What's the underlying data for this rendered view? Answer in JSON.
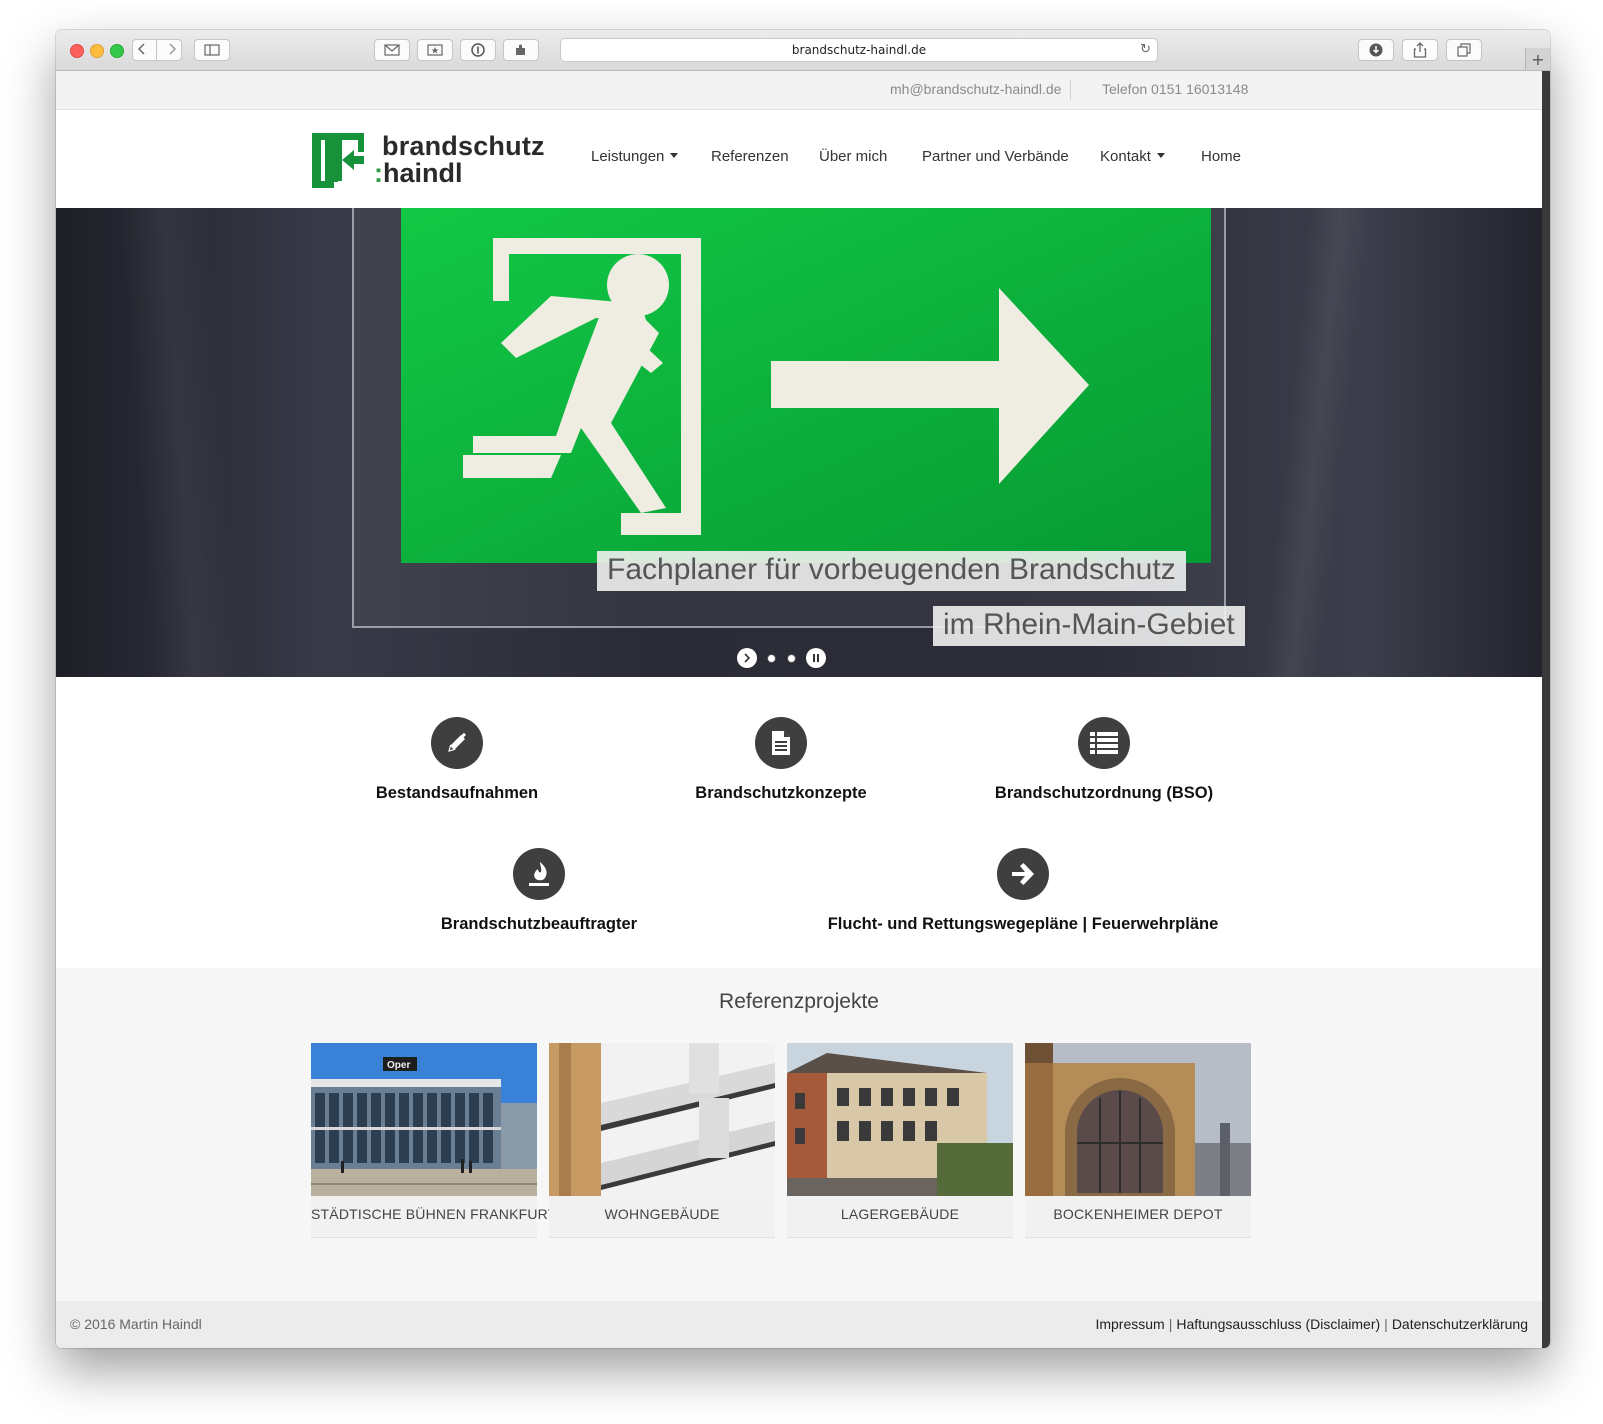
{
  "browser": {
    "url": "brandschutz-haindl.de"
  },
  "topbar": {
    "email": "mh@brandschutz-haindl.de",
    "phone": "Telefon 0151 16013148"
  },
  "logo": {
    "word1": "brandschutz",
    "colon": ":",
    "word2": "haindl",
    "brand_color": "#18923a"
  },
  "nav": {
    "items": [
      {
        "label": "Leistungen",
        "dropdown": true
      },
      {
        "label": "Referenzen",
        "dropdown": false
      },
      {
        "label": "Über mich",
        "dropdown": false
      },
      {
        "label": "Partner und Verbände",
        "dropdown": false
      },
      {
        "label": "Kontakt",
        "dropdown": true
      },
      {
        "label": "Home",
        "dropdown": false
      }
    ]
  },
  "hero": {
    "caption1": "Fachplaner für vorbeugenden Brandschutz",
    "caption2": "im Rhein-Main-Gebiet",
    "sign_color": "#0bb13e",
    "slides": 2,
    "active_slide": 1
  },
  "services": [
    {
      "label": "Bestandsaufnahmen",
      "icon": "pencil-icon"
    },
    {
      "label": "Brandschutzkonzepte",
      "icon": "document-icon"
    },
    {
      "label": "Brandschutzordnung (BSO)",
      "icon": "list-icon"
    },
    {
      "label": "Brandschutzbeauftragter",
      "icon": "flame-icon"
    },
    {
      "label": "Flucht- und Rettungswegepläne | Feuerwehrpläne",
      "icon": "arrow-right-icon"
    }
  ],
  "references": {
    "title": "Referenzprojekte",
    "items": [
      {
        "label": "STÄDTISCHE BÜHNEN FRANKFURT",
        "sign_text": "Oper"
      },
      {
        "label": "WOHNGEBÄUDE"
      },
      {
        "label": "LAGERGEBÄUDE"
      },
      {
        "label": "BOCKENHEIMER DEPOT"
      }
    ]
  },
  "footer": {
    "copyright": "© 2016 Martin Haindl",
    "links": [
      "Impressum",
      "Haftungsausschluss (Disclaimer)",
      "Datenschutzerklärung"
    ],
    "separator": "|"
  }
}
